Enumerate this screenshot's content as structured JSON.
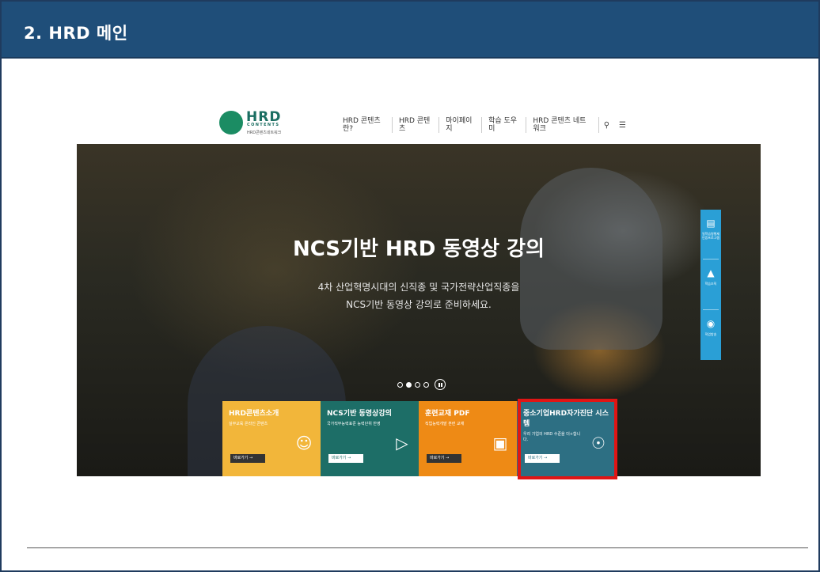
{
  "slide": {
    "title": "2. HRD 메인"
  },
  "site": {
    "logo": {
      "main": "HRD",
      "sub": "CONTENTS",
      "caption": "HRD콘텐츠네트워크"
    },
    "nav": [
      "HRD 콘텐츠란?",
      "HRD 콘텐츠",
      "마이페이지",
      "학습 도우미",
      "HRD 콘텐츠 네트워크"
    ],
    "nav_icons": [
      "search-icon",
      "menu-icon"
    ]
  },
  "hero": {
    "headline": "NCS기반 HRD 동영상 강의",
    "sub_line1": "4차 산업혁명시대의 신직종 및 국가전략산업직종을",
    "sub_line2": "NCS기반 동영상 강의로 준비하세요.",
    "slides_total": 4,
    "slide_active": 2
  },
  "side_panel": [
    {
      "icon": "document-icon",
      "label": "일학습병행제 인증프로그램"
    },
    {
      "icon": "cone-icon",
      "label": "학습조직"
    },
    {
      "icon": "camera-icon",
      "label": "직업방송"
    }
  ],
  "cards": [
    {
      "title": "HRD콘텐츠소개",
      "desc": "실무교육 온라인 콘텐츠",
      "button": "바로가기 →",
      "icon": "person-icon",
      "color": "#f2b63a"
    },
    {
      "title": "NCS기반 동영상강의",
      "desc": "국가직무능력표준 능력단위 반영",
      "button": "바로가기 →",
      "icon": "monitor-play-icon",
      "color": "#1d6e67"
    },
    {
      "title": "훈련교재 PDF",
      "desc": "직업능력개발 훈련 교재",
      "button": "바로가기 →",
      "icon": "laptop-icon",
      "color": "#ee8a15"
    },
    {
      "title": "중소기업HRD자가진단 시스템",
      "desc": "우리 기업의 HRD 수준을 더+합니다.",
      "button": "바로가기 →",
      "icon": "globe-search-icon",
      "color": "#2d6f83"
    }
  ],
  "highlight_color": "#e01515"
}
